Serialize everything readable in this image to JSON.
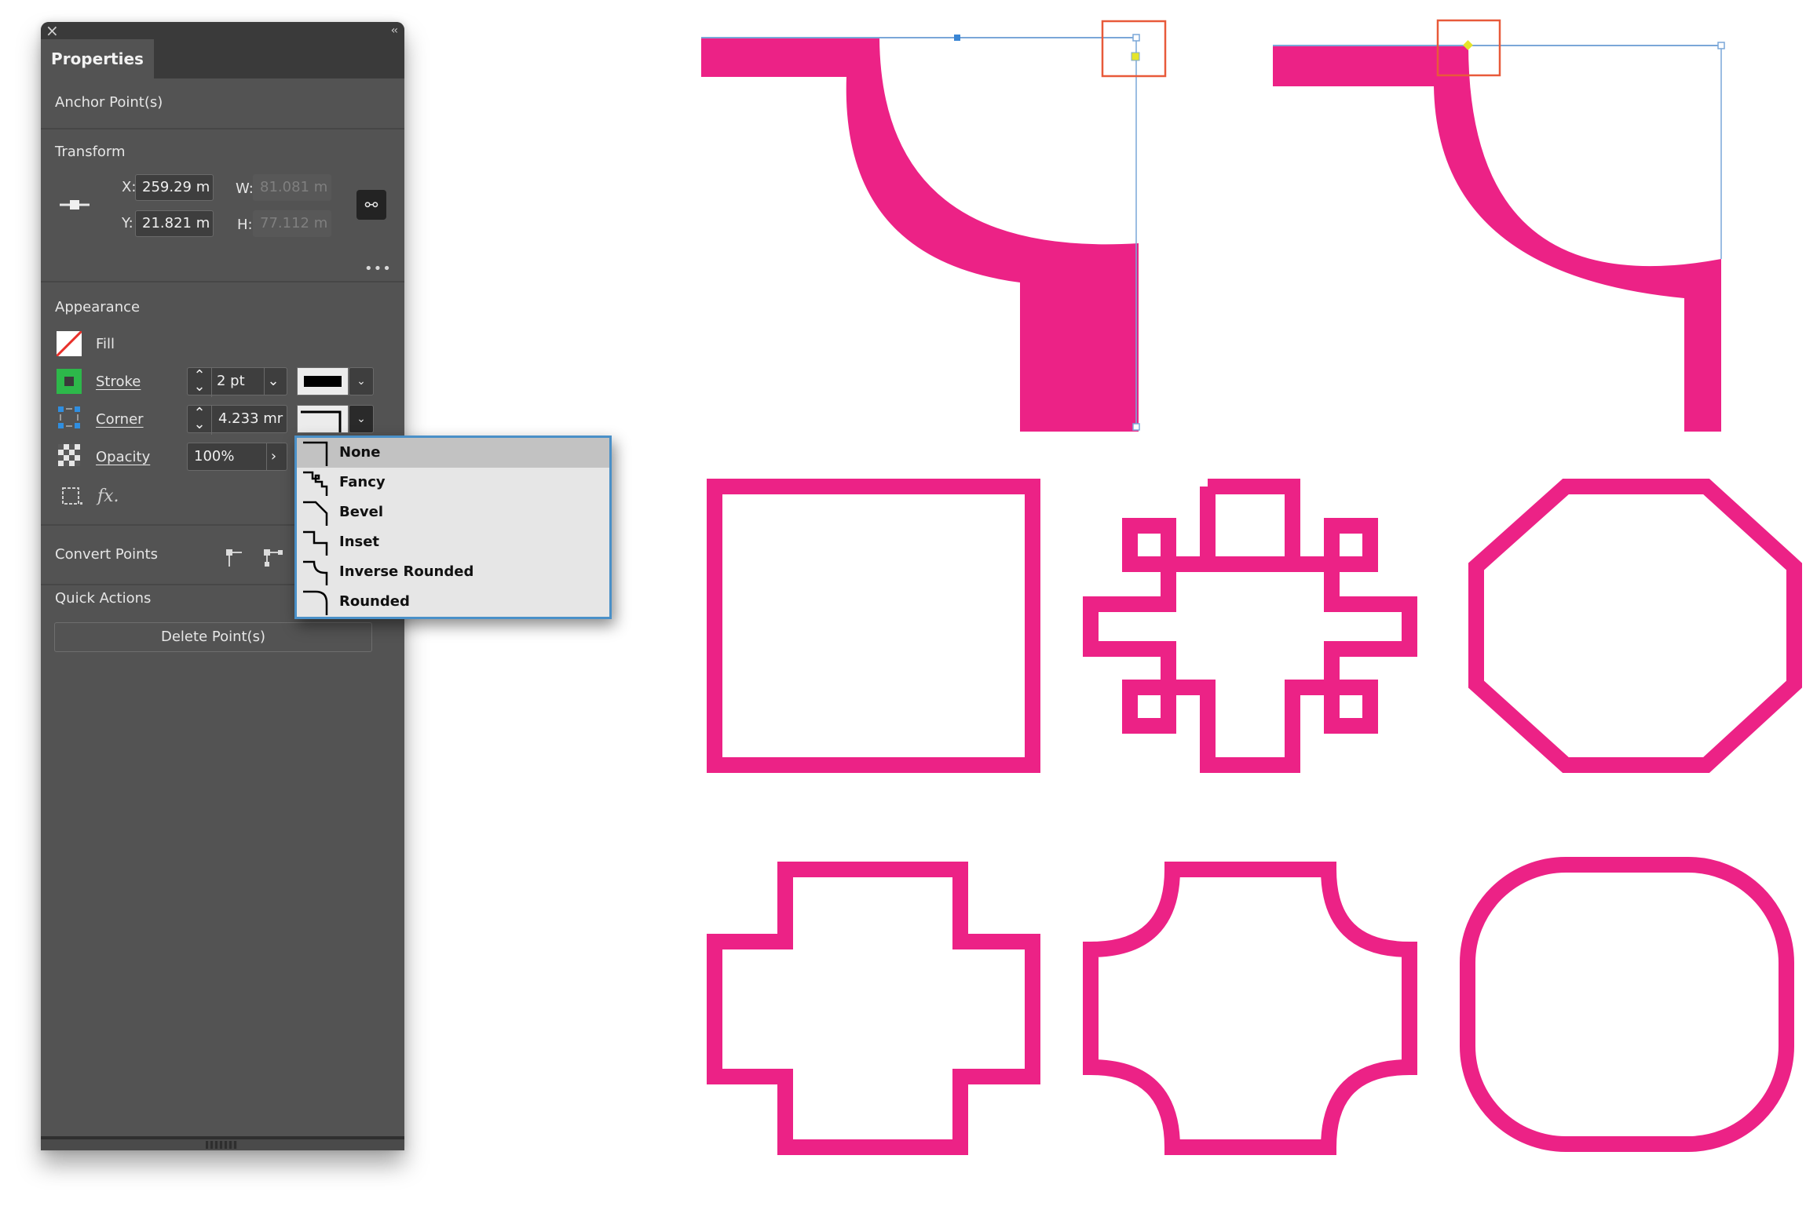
{
  "panel": {
    "tab_label": "Properties",
    "close_icon": "close-icon",
    "collapse_icon": "double-chevron-left-icon",
    "selection_title": "Anchor Point(s)",
    "transform": {
      "title": "Transform",
      "x_label": "X:",
      "x_value": "259.29 m",
      "y_label": "Y:",
      "y_value": "21.821 m",
      "w_label": "W:",
      "w_value": "81.081 m",
      "h_label": "H:",
      "h_value": "77.112 m",
      "link_icon": "link-icon",
      "more_label": "•••"
    },
    "appearance": {
      "title": "Appearance",
      "fill_label": "Fill",
      "stroke_label": "Stroke",
      "stroke_weight": "2 pt",
      "corner_label": "Corner",
      "corner_radius": "4.233 mr",
      "opacity_label": "Opacity",
      "opacity_value": "100%",
      "fx_label": "fx."
    },
    "convert_points": {
      "title": "Convert Points"
    },
    "quick_actions": {
      "title": "Quick Actions",
      "delete_button": "Delete Point(s)"
    }
  },
  "corner_menu": {
    "selected": "None",
    "items": [
      {
        "label": "None"
      },
      {
        "label": "Fancy"
      },
      {
        "label": "Bevel"
      },
      {
        "label": "Inset"
      },
      {
        "label": "Inverse Rounded"
      },
      {
        "label": "Rounded"
      }
    ]
  },
  "canvas": {
    "shape_color": "#ec2286",
    "selection_color": "#4a90d9",
    "highlight_color": "#e85a3a",
    "shapes": [
      "inverse-rounded-corner-detail-1",
      "inverse-rounded-corner-detail-2",
      "none-rectangle",
      "fancy-cross",
      "bevel-octagon",
      "inset-cross",
      "inverse-rounded-rectangle",
      "rounded-rectangle"
    ]
  }
}
